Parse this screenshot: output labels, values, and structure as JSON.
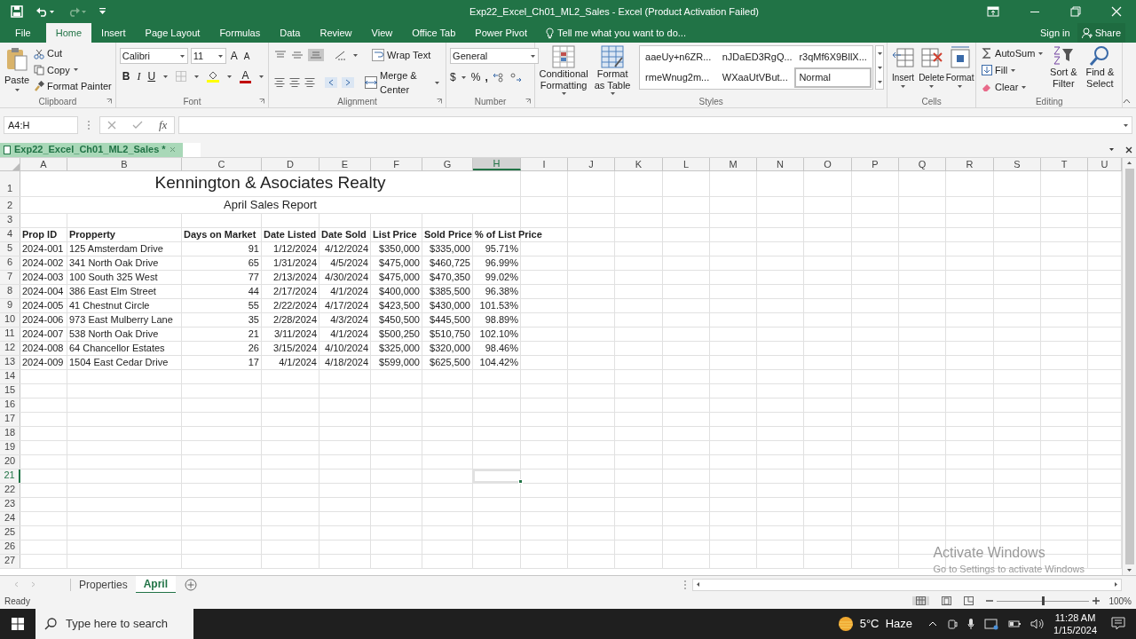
{
  "window": {
    "title": "Exp22_Excel_Ch01_ML2_Sales - Excel (Product Activation Failed)"
  },
  "menu_tabs": [
    {
      "label": "File",
      "selected": false
    },
    {
      "label": "Home",
      "selected": true
    },
    {
      "label": "Insert",
      "selected": false
    },
    {
      "label": "Page Layout",
      "selected": false
    },
    {
      "label": "Formulas",
      "selected": false
    },
    {
      "label": "Data",
      "selected": false
    },
    {
      "label": "Review",
      "selected": false
    },
    {
      "label": "View",
      "selected": false
    },
    {
      "label": "Office Tab",
      "selected": false
    },
    {
      "label": "Power Pivot",
      "selected": false
    }
  ],
  "tell_me": {
    "placeholder": "Tell me what you want to do..."
  },
  "account": {
    "sign_in": "Sign in",
    "share": "Share"
  },
  "ribbon": {
    "clipboard": {
      "paste": "Paste",
      "cut": "Cut",
      "copy": "Copy",
      "format_painter": "Format Painter",
      "label": "Clipboard"
    },
    "font": {
      "name": "Calibri",
      "size": "11",
      "grow": "A",
      "shrink": "A",
      "bold": "B",
      "italic": "I",
      "underline": "U",
      "font_color": "A",
      "label": "Font"
    },
    "alignment": {
      "wrap": "Wrap Text",
      "merge": "Merge & Center",
      "label": "Alignment"
    },
    "number": {
      "format": "General",
      "currency": "$",
      "percent": "%",
      "comma": ",",
      "label": "Number"
    },
    "styles": {
      "conditional": "Conditional Formatting",
      "format_table": "Format as Table",
      "label": "Styles",
      "gallery": [
        {
          "label": "aaeUy+n6ZR...",
          "selected": false
        },
        {
          "label": "nJDaED3RgQ...",
          "selected": false
        },
        {
          "label": "r3qMf6X9BllX...",
          "selected": false
        },
        {
          "label": "rmeWnug2m...",
          "selected": false
        },
        {
          "label": "WXaaUtVBut...",
          "selected": false
        },
        {
          "label": "Normal",
          "selected": true
        }
      ]
    },
    "cells": {
      "insert": "Insert",
      "delete": "Delete",
      "format": "Format",
      "label": "Cells"
    },
    "editing": {
      "autosum": "AutoSum",
      "fill": "Fill",
      "clear": "Clear",
      "sort": "Sort & Filter",
      "find": "Find & Select",
      "label": "Editing"
    }
  },
  "formula_bar": {
    "name_box": "A4:H",
    "function_label": "fx"
  },
  "workbook_tab": {
    "label": "Exp22_Excel_Ch01_ML2_Sales *"
  },
  "columns": [
    {
      "label": "A",
      "selected": false
    },
    {
      "label": "B",
      "selected": false
    },
    {
      "label": "C",
      "selected": false
    },
    {
      "label": "D",
      "selected": false
    },
    {
      "label": "E",
      "selected": false
    },
    {
      "label": "F",
      "selected": false
    },
    {
      "label": "G",
      "selected": false
    },
    {
      "label": "H",
      "selected": true
    },
    {
      "label": "I",
      "selected": false
    },
    {
      "label": "J",
      "selected": false
    },
    {
      "label": "K",
      "selected": false
    },
    {
      "label": "L",
      "selected": false
    },
    {
      "label": "M",
      "selected": false
    },
    {
      "label": "N",
      "selected": false
    },
    {
      "label": "O",
      "selected": false
    },
    {
      "label": "P",
      "selected": false
    },
    {
      "label": "Q",
      "selected": false
    },
    {
      "label": "R",
      "selected": false
    },
    {
      "label": "S",
      "selected": false
    },
    {
      "label": "T",
      "selected": false
    },
    {
      "label": "U",
      "selected": false
    }
  ],
  "rows": [
    {
      "number": "1",
      "kind": "title",
      "selected": false,
      "text": "Kennington & Asociates Realty"
    },
    {
      "number": "2",
      "kind": "subtitle",
      "selected": false,
      "text": "April Sales Report"
    },
    {
      "number": "3",
      "kind": "empty",
      "selected": false
    },
    {
      "number": "4",
      "kind": "header",
      "selected": false,
      "cells": [
        "Prop ID",
        "Propperty",
        "Days on Market",
        "Date Listed",
        "Date Sold",
        "List Price",
        "Sold Price",
        "% of List Price"
      ]
    },
    {
      "number": "5",
      "kind": "data",
      "selected": false,
      "cells": [
        "2024-001",
        "125 Amsterdam Drive",
        "91",
        "1/12/2024",
        "4/12/2024",
        "$350,000",
        "$335,000",
        "95.71%"
      ]
    },
    {
      "number": "6",
      "kind": "data",
      "selected": false,
      "cells": [
        "2024-002",
        "341 North Oak Drive",
        "65",
        "1/31/2024",
        "4/5/2024",
        "$475,000",
        "$460,725",
        "96.99%"
      ]
    },
    {
      "number": "7",
      "kind": "data",
      "selected": false,
      "cells": [
        "2024-003",
        "100 South 325 West",
        "77",
        "2/13/2024",
        "4/30/2024",
        "$475,000",
        "$470,350",
        "99.02%"
      ]
    },
    {
      "number": "8",
      "kind": "data",
      "selected": false,
      "cells": [
        "2024-004",
        "386 East Elm Street",
        "44",
        "2/17/2024",
        "4/1/2024",
        "$400,000",
        "$385,500",
        "96.38%"
      ]
    },
    {
      "number": "9",
      "kind": "data",
      "selected": false,
      "cells": [
        "2024-005",
        "41 Chestnut Circle",
        "55",
        "2/22/2024",
        "4/17/2024",
        "$423,500",
        "$430,000",
        "101.53%"
      ]
    },
    {
      "number": "10",
      "kind": "data",
      "selected": false,
      "cells": [
        "2024-006",
        "973 East Mulberry Lane",
        "35",
        "2/28/2024",
        "4/3/2024",
        "$450,500",
        "$445,500",
        "98.89%"
      ]
    },
    {
      "number": "11",
      "kind": "data",
      "selected": false,
      "cells": [
        "2024-007",
        "538 North Oak Drive",
        "21",
        "3/11/2024",
        "4/1/2024",
        "$500,250",
        "$510,750",
        "102.10%"
      ]
    },
    {
      "number": "12",
      "kind": "data",
      "selected": false,
      "cells": [
        "2024-008",
        "64 Chancellor Estates",
        "26",
        "3/15/2024",
        "4/10/2024",
        "$325,000",
        "$320,000",
        "98.46%"
      ]
    },
    {
      "number": "13",
      "kind": "data",
      "selected": false,
      "cells": [
        "2024-009",
        "1504 East Cedar Drive",
        "17",
        "4/1/2024",
        "4/18/2024",
        "$599,000",
        "$625,500",
        "104.42%"
      ]
    },
    {
      "number": "14",
      "kind": "empty",
      "selected": false
    },
    {
      "number": "15",
      "kind": "empty",
      "selected": false
    },
    {
      "number": "16",
      "kind": "empty",
      "selected": false
    },
    {
      "number": "17",
      "kind": "empty",
      "selected": false
    },
    {
      "number": "18",
      "kind": "empty",
      "selected": false
    },
    {
      "number": "19",
      "kind": "empty",
      "selected": false
    },
    {
      "number": "20",
      "kind": "empty",
      "selected": false
    },
    {
      "number": "21",
      "kind": "empty",
      "selected": true
    },
    {
      "number": "22",
      "kind": "empty",
      "selected": false
    },
    {
      "number": "23",
      "kind": "empty",
      "selected": false
    },
    {
      "number": "24",
      "kind": "empty",
      "selected": false
    },
    {
      "number": "25",
      "kind": "empty",
      "selected": false
    },
    {
      "number": "26",
      "kind": "empty",
      "selected": false
    },
    {
      "number": "27",
      "kind": "empty",
      "selected": false
    }
  ],
  "activation_notice": {
    "title": "Activate Windows",
    "detail": "Go to Settings to activate Windows"
  },
  "sheet_tabs": [
    {
      "label": "Properties",
      "selected": false
    },
    {
      "label": "April",
      "selected": true
    }
  ],
  "status_bar": {
    "text": "Ready",
    "zoom": "100%",
    "zoom_slider": {
      "level": 0.5
    }
  },
  "taskbar": {
    "search_placeholder": "Type here to search",
    "weather": "5°C  Haze",
    "time": "11:28 AM",
    "date": "1/15/2024"
  }
}
